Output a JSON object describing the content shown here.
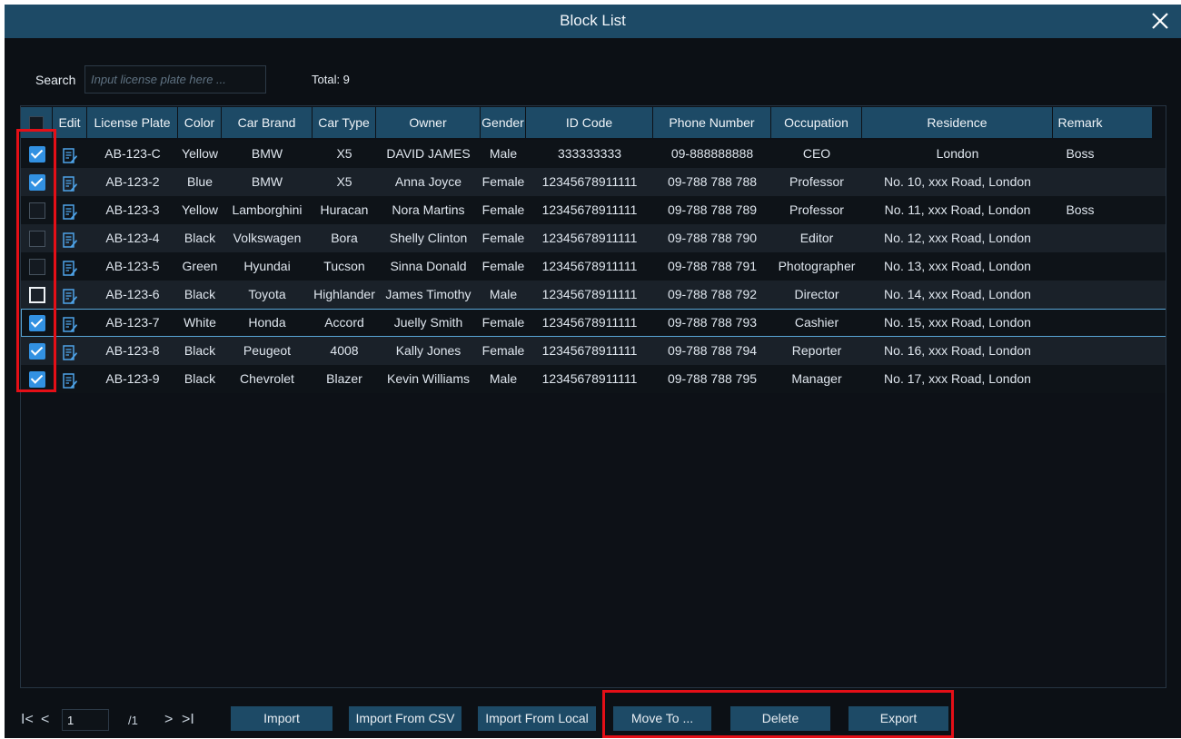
{
  "window": {
    "title": "Block List"
  },
  "search": {
    "label": "Search",
    "placeholder": "Input license plate here ...",
    "value": ""
  },
  "total": "Total: 9",
  "columns": [
    "",
    "Edit",
    "License Plate",
    "Color",
    "Car Brand",
    "Car Type",
    "Owner",
    "Gender",
    "ID Code",
    "Phone Number",
    "Occupation",
    "Residence",
    "Remark"
  ],
  "rows": [
    {
      "checked": true,
      "plate": "AB-123-C",
      "color": "Yellow",
      "brand": "BMW",
      "type": "X5",
      "owner": "DAVID JAMES",
      "gender": "Male",
      "id": "333333333",
      "phone": "09-888888888",
      "occupation": "CEO",
      "residence": "London",
      "remark": "Boss"
    },
    {
      "checked": true,
      "plate": "AB-123-2",
      "color": "Blue",
      "brand": "BMW",
      "type": "X5",
      "owner": "Anna Joyce",
      "gender": "Female",
      "id": "12345678911111",
      "phone": "09-788 788 788",
      "occupation": "Professor",
      "residence": "No. 10, xxx Road, London",
      "remark": ""
    },
    {
      "checked": false,
      "plate": "AB-123-3",
      "color": "Yellow",
      "brand": "Lamborghini",
      "type": "Huracan",
      "owner": "Nora Martins",
      "gender": "Female",
      "id": "12345678911111",
      "phone": "09-788 788 789",
      "occupation": "Professor",
      "residence": "No. 11, xxx Road, London",
      "remark": "Boss"
    },
    {
      "checked": false,
      "plate": "AB-123-4",
      "color": "Black",
      "brand": "Volkswagen",
      "type": "Bora",
      "owner": "Shelly Clinton",
      "gender": "Female",
      "id": "12345678911111",
      "phone": "09-788 788 790",
      "occupation": "Editor",
      "residence": "No. 12, xxx Road, London",
      "remark": ""
    },
    {
      "checked": false,
      "plate": "AB-123-5",
      "color": "Green",
      "brand": "Hyundai",
      "type": "Tucson",
      "owner": "Sinna Donald",
      "gender": "Female",
      "id": "12345678911111",
      "phone": "09-788 788 791",
      "occupation": "Photographer",
      "residence": "No. 13, xxx Road, London",
      "remark": ""
    },
    {
      "checked": false,
      "plate": "AB-123-6",
      "color": "Black",
      "brand": "Toyota",
      "type": "Highlander",
      "owner": "James Timothy",
      "gender": "Male",
      "id": "12345678911111",
      "phone": "09-788 788 792",
      "occupation": "Director",
      "residence": "No. 14, xxx Road, London",
      "remark": ""
    },
    {
      "checked": true,
      "plate": "AB-123-7",
      "color": "White",
      "brand": "Honda",
      "type": "Accord",
      "owner": "Juelly Smith",
      "gender": "Female",
      "id": "12345678911111",
      "phone": "09-788 788 793",
      "occupation": "Cashier",
      "residence": "No. 15, xxx Road, London",
      "remark": "",
      "selected": true
    },
    {
      "checked": true,
      "plate": "AB-123-8",
      "color": "Black",
      "brand": "Peugeot",
      "type": "4008",
      "owner": "Kally Jones",
      "gender": "Female",
      "id": "12345678911111",
      "phone": "09-788 788 794",
      "occupation": "Reporter",
      "residence": "No. 16, xxx Road, London",
      "remark": ""
    },
    {
      "checked": true,
      "plate": "AB-123-9",
      "color": "Black",
      "brand": "Chevrolet",
      "type": "Blazer",
      "owner": "Kevin Williams",
      "gender": "Male",
      "id": "12345678911111",
      "phone": "09-788 788 795",
      "occupation": "Manager",
      "residence": "No. 17, xxx Road, London",
      "remark": ""
    }
  ],
  "pagination": {
    "first": "I<",
    "prev": "<",
    "current": "1",
    "total": "/1",
    "next": ">",
    "last": ">I"
  },
  "buttons": {
    "import": "Import",
    "import_csv": "Import From CSV",
    "import_local": "Import From Local",
    "move_to": "Move To ...",
    "delete": "Delete",
    "export": "Export"
  },
  "colors": {
    "header": "#1d4a66",
    "accent": "#3291e2",
    "highlight": "#e40f17"
  }
}
